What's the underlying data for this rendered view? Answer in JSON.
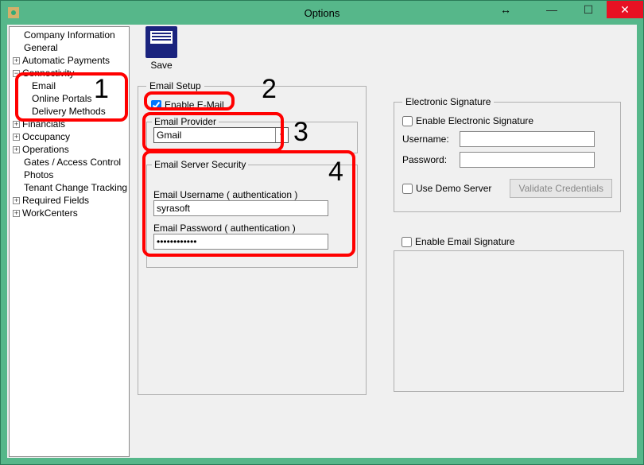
{
  "window": {
    "title": "Options"
  },
  "tree": {
    "items": [
      {
        "label": "Company Information",
        "exp": null,
        "indent": 0
      },
      {
        "label": "General",
        "exp": null,
        "indent": 0
      },
      {
        "label": "Automatic Payments",
        "exp": "+",
        "indent": 0
      },
      {
        "label": "Connectivity",
        "exp": "−",
        "indent": 0
      },
      {
        "label": "Email",
        "exp": null,
        "indent": 1
      },
      {
        "label": "Online Portals",
        "exp": null,
        "indent": 1
      },
      {
        "label": "Delivery Methods",
        "exp": null,
        "indent": 1
      },
      {
        "label": "Financials",
        "exp": "+",
        "indent": 0
      },
      {
        "label": "Occupancy",
        "exp": "+",
        "indent": 0
      },
      {
        "label": "Operations",
        "exp": "+",
        "indent": 0
      },
      {
        "label": "Gates / Access Control",
        "exp": null,
        "indent": 0
      },
      {
        "label": "Photos",
        "exp": null,
        "indent": 0
      },
      {
        "label": "Tenant Change Tracking",
        "exp": null,
        "indent": 0
      },
      {
        "label": "Required Fields",
        "exp": "+",
        "indent": 0
      },
      {
        "label": "WorkCenters",
        "exp": "+",
        "indent": 0
      }
    ]
  },
  "toolbar": {
    "save_label": "Save"
  },
  "email_setup": {
    "legend": "Email Setup",
    "enable_label": "Enable E-Mail",
    "enable_checked": true,
    "provider_group": "Email Provider",
    "provider_value": "Gmail",
    "security_group": "Email Server Security",
    "username_label": "Email Username ( authentication )",
    "username_value": "syrasoft",
    "password_label": "Email Password ( authentication )",
    "password_value": "************"
  },
  "signature": {
    "legend": "Electronic Signature",
    "enable_es_label": "Enable Electronic Signature",
    "username_label": "Username:",
    "password_label": "Password:",
    "demo_label": "Use Demo Server",
    "validate_label": "Validate Credentials",
    "enable_emailsig_label": "Enable Email Signature"
  },
  "annotations": {
    "n1": "1",
    "n2": "2",
    "n3": "3",
    "n4": "4"
  }
}
